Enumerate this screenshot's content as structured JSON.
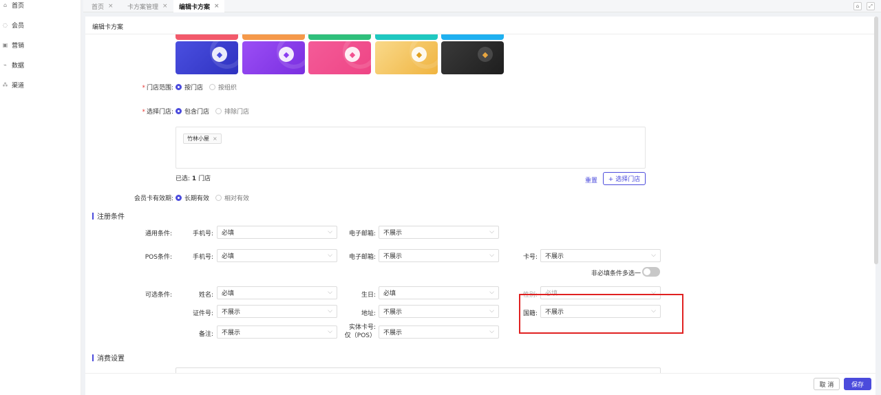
{
  "sidebar": {
    "items": [
      {
        "label": "首页",
        "icon": "home-icon"
      },
      {
        "label": "会员",
        "icon": "member-icon"
      },
      {
        "label": "营销",
        "icon": "marketing-icon"
      },
      {
        "label": "数据",
        "icon": "chart-icon"
      },
      {
        "label": "渠道",
        "icon": "channel-icon"
      }
    ]
  },
  "tabs": [
    {
      "label": "首页"
    },
    {
      "label": "卡方案管理"
    },
    {
      "label": "编辑卡方案"
    }
  ],
  "page_title": "编辑卡方案",
  "cards": {
    "colors": [
      "#3e42d6",
      "#8b3df0",
      "#f2508f",
      "#f5c55b",
      "#2b2b2b"
    ],
    "top_strip_colors": [
      "#f25a6b",
      "#f5994a",
      "#2fbf7b",
      "#1fc8c0",
      "#1fb0f0"
    ]
  },
  "store_scope": {
    "label": "门店范围:",
    "options": [
      "按门店",
      "按组织"
    ],
    "selected": "按门店"
  },
  "store_select": {
    "label": "选择门店:",
    "options": [
      "包含门店",
      "排除门店"
    ],
    "selected": "包含门店",
    "tags": [
      "竹林小屋"
    ],
    "count_prefix": "已选:",
    "count": "1",
    "count_suffix": "门店",
    "reset_label": "重置",
    "choose_label": "+ 选择门店"
  },
  "validity": {
    "label": "会员卡有效期:",
    "options": [
      "长期有效",
      "相对有效"
    ],
    "selected": "长期有效"
  },
  "register_section": {
    "title": "注册条件",
    "general": {
      "label": "通用条件:",
      "phone_label": "手机号:",
      "phone_value": "必填",
      "email_label": "电子邮箱:",
      "email_value": "不展示"
    },
    "pos": {
      "label": "POS条件:",
      "phone_label": "手机号:",
      "phone_value": "必填",
      "email_label": "电子邮箱:",
      "email_value": "不展示",
      "card_label": "卡号:",
      "card_value": "不展示"
    },
    "multi_toggle_label": "非必填条件多选一",
    "optional": {
      "label": "可选条件:",
      "name_label": "姓名:",
      "name_value": "必填",
      "birthday_label": "生日:",
      "birthday_value": "必填",
      "gender_label": "性别:",
      "gender_value": "必填",
      "id_label": "证件号:",
      "id_value": "不展示",
      "address_label": "地址:",
      "address_value": "不展示",
      "nationality_label": "国籍:",
      "nationality_value": "不展示",
      "remark_label": "备注:",
      "remark_value": "不展示",
      "physical_card_label_1": "实体卡号:",
      "physical_card_label_2": "仅（POS）",
      "physical_card_value": "不展示"
    }
  },
  "consume_section": {
    "title": "消费设置"
  },
  "footer": {
    "cancel_label": "取 消",
    "save_label": "保存"
  },
  "colors": {
    "accent": "#4b4bdc",
    "highlight": "#e02020"
  }
}
